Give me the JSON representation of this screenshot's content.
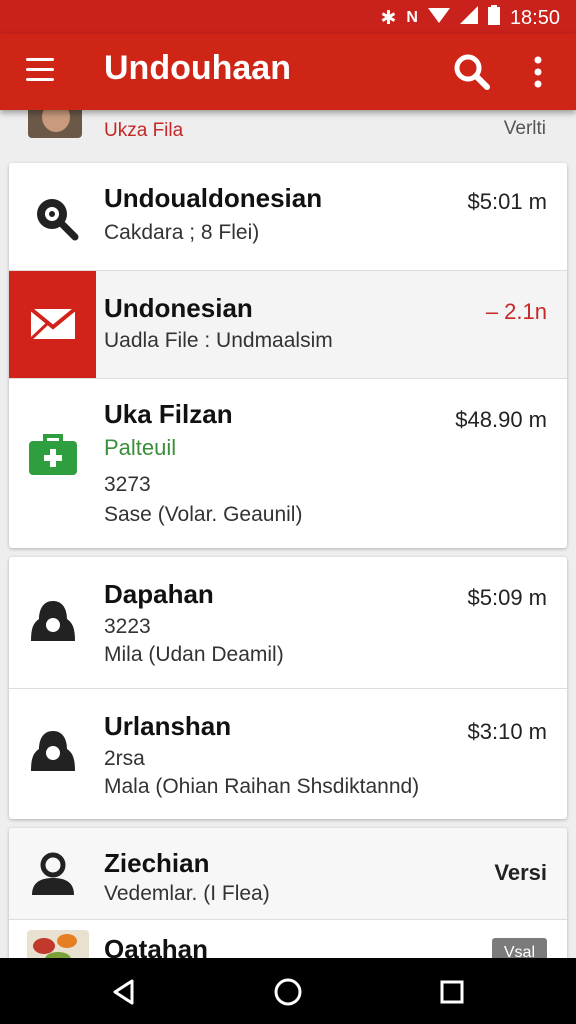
{
  "status_bar": {
    "time": "18:50",
    "icons": [
      "bluetooth-icon",
      "nfc-icon",
      "wifi-icon",
      "signal-icon",
      "battery-icon"
    ]
  },
  "app_bar": {
    "title": "Undouhaan",
    "colors": {
      "primary": "#cf2517",
      "status": "#c9211b"
    }
  },
  "partial_item": {
    "subtitle": "Ukza Fila",
    "right": "Verlti"
  },
  "cards": [
    {
      "items": [
        {
          "icon": "search-icon",
          "title": "Undoualdonesian",
          "subtitle": "Cakdara ; 8 Flei)",
          "price": "$5:01 m"
        },
        {
          "icon": "mail-icon",
          "title": "Undonesian",
          "subtitle": "Uadla File : Undmaalsim",
          "price": "– 2.1n",
          "highlight": "#d2231b"
        },
        {
          "icon": "medkit-icon",
          "title": "Uka Filzan",
          "subtitle": "Palteuil",
          "line3": "3273",
          "line4": "Sase (Volar. Geaunil)",
          "price": "$48.90 m"
        }
      ]
    },
    {
      "items": [
        {
          "icon": "user-icon",
          "title": "Dapahan",
          "subtitle": "3223",
          "line3": "Mila (Udan Deamil)",
          "price": "$5:09 m"
        },
        {
          "icon": "user-icon",
          "title": "Urlanshan",
          "subtitle": "2rsa",
          "line3": "Mala (Ohian Raihan Shsdiktannd)",
          "price": "$3:10 m"
        }
      ]
    },
    {
      "items": [
        {
          "icon": "person-icon",
          "title": "Ziechian",
          "subtitle": "Vedemlar. (I Flea)",
          "price": "Versi"
        },
        {
          "icon": "food-thumbnail-icon",
          "title": "Oatahan",
          "badge": "Vsal"
        }
      ]
    }
  ],
  "nav_bar": {
    "items": [
      "back-icon",
      "home-icon",
      "recents-icon"
    ]
  }
}
